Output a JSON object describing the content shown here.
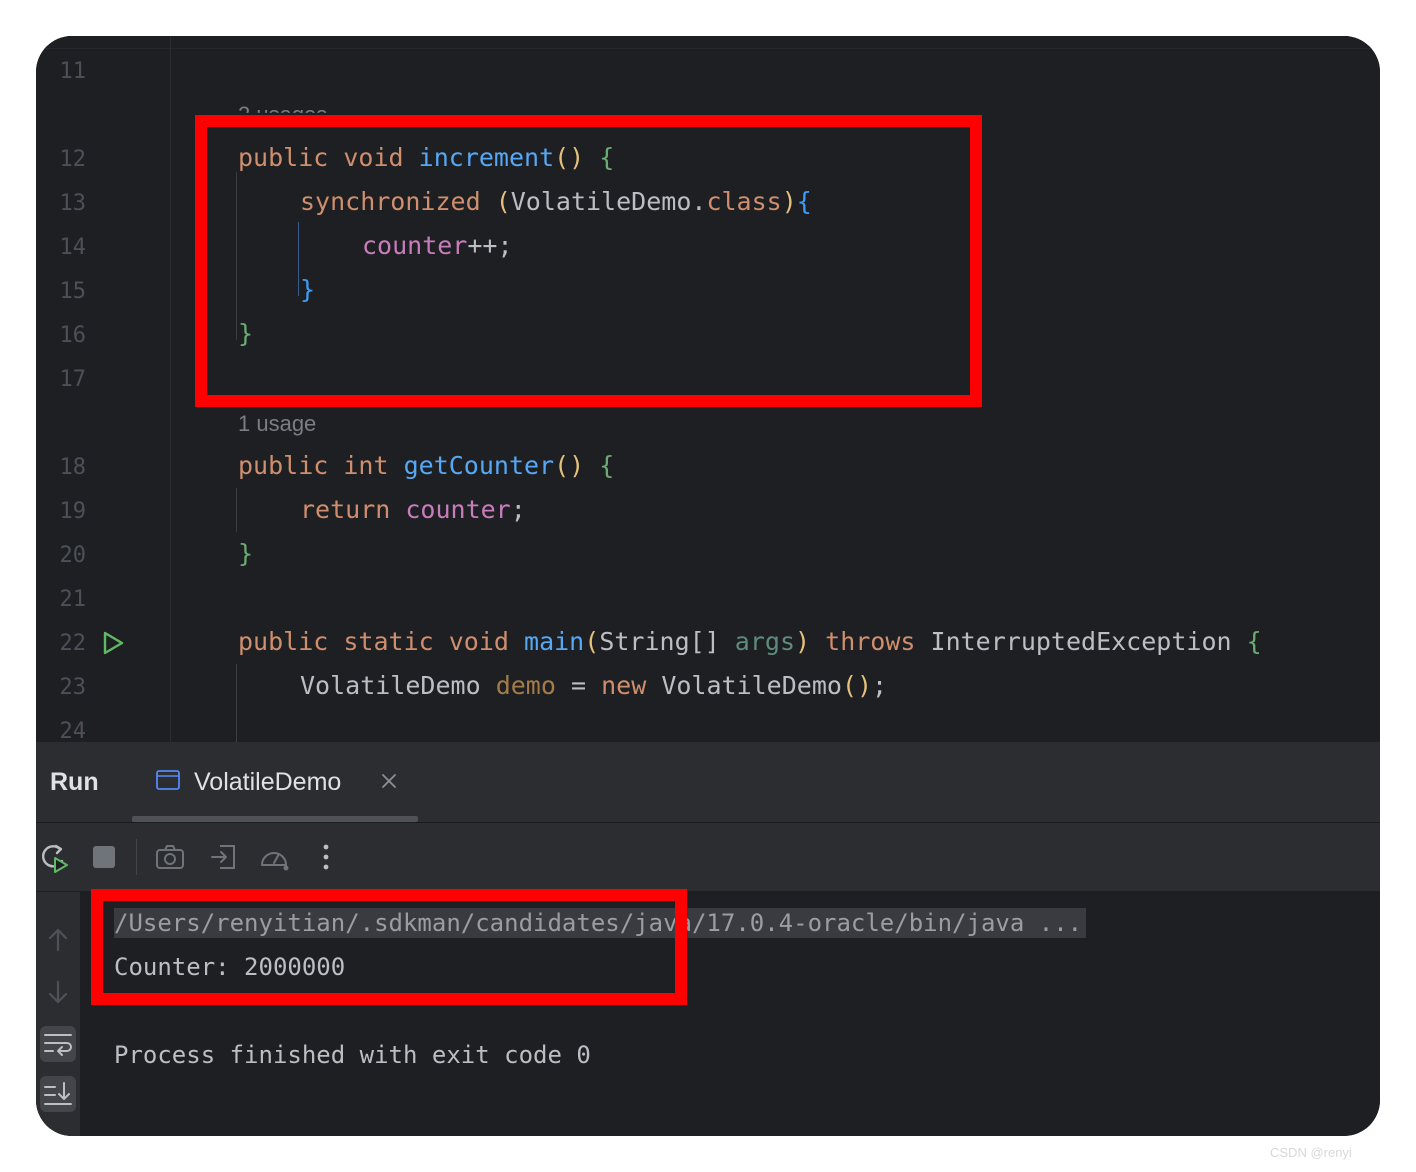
{
  "editor": {
    "line_numbers": [
      "11",
      "12",
      "13",
      "14",
      "15",
      "16",
      "17",
      "18",
      "19",
      "20",
      "21",
      "22",
      "23",
      "24"
    ],
    "hint_top": "2 usages",
    "hint_mid": "1 usage",
    "code": {
      "l12": {
        "kw1": "public",
        "kw2": "void",
        "fn": "increment",
        "paren": "()",
        "brace": "{"
      },
      "l13": {
        "kw": "synchronized",
        "open": "(",
        "type": "VolatileDemo",
        "dot": ".",
        "cls": "class",
        "close": ")",
        "brace": "{"
      },
      "l14": {
        "field": "counter",
        "rest": "++;"
      },
      "l15": {
        "brace": "}"
      },
      "l16": {
        "brace": "}"
      },
      "l18": {
        "kw1": "public",
        "kw2": "int",
        "fn": "getCounter",
        "paren": "()",
        "brace": "{"
      },
      "l19": {
        "kw": "return",
        "field": "counter",
        "semi": ";"
      },
      "l20": {
        "brace": "}"
      },
      "l22": {
        "kw1": "public",
        "kw2": "static",
        "kw3": "void",
        "fn": "main",
        "open": "(",
        "type": "String[]",
        "param": "args",
        "close": ")",
        "kw4": "throws",
        "exc": "InterruptedException",
        "brace": "{"
      },
      "l23": {
        "type": "VolatileDemo",
        "local": "demo",
        "eq": "=",
        "kw": "new",
        "ctor": "VolatileDemo",
        "paren": "()",
        "semi": ";"
      }
    }
  },
  "run_panel": {
    "title": "Run",
    "tab_label": "VolatileDemo",
    "console": {
      "command": "/Users/renyitian/.sdkman/candidates/java/17.0.4-oracle/bin/java ...",
      "output": "Counter: 2000000",
      "exit": "Process finished with exit code 0"
    }
  },
  "icons": {
    "gutter": "run-gutter-icon",
    "toolbar": [
      "rerun-icon",
      "stop-icon",
      "camera-icon",
      "restore-layout-icon",
      "profiler-icon",
      "more-vertical-icon"
    ],
    "side": [
      "arrow-up-icon",
      "arrow-down-icon",
      "soft-wrap-icon",
      "scroll-to-end-icon"
    ]
  },
  "colors": {
    "highlight_box": "#ff0000",
    "editor_bg": "#1e1f22",
    "keyword": "#cf8e6d",
    "method": "#56a8f5",
    "field": "#c77dbb"
  },
  "watermark": "CSDN @renyi"
}
